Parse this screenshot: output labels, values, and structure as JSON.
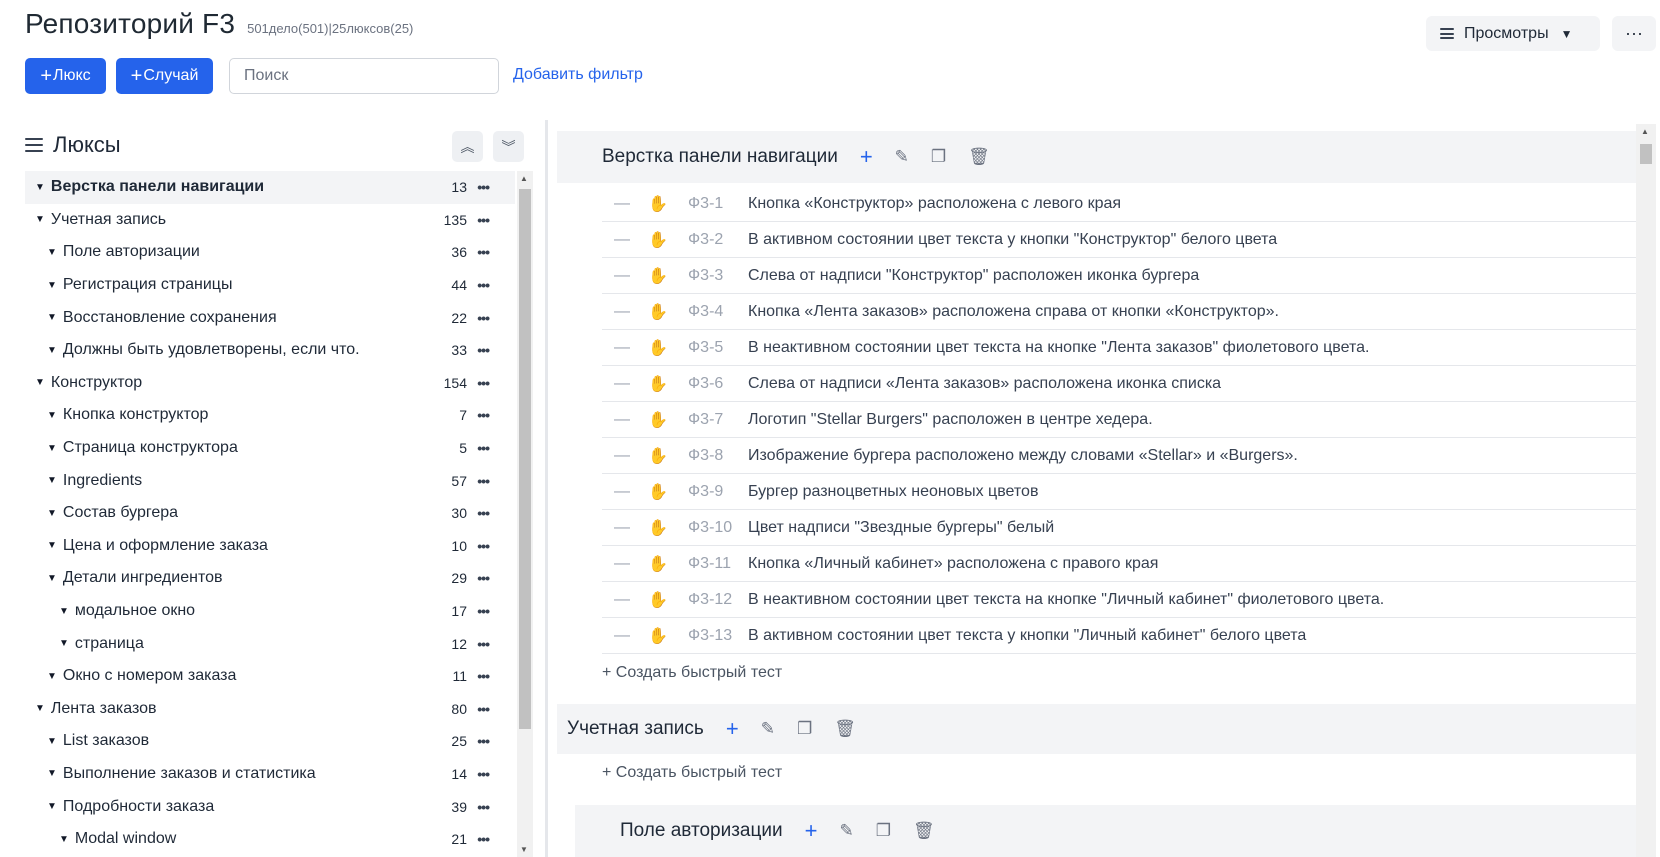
{
  "header": {
    "title": "Репозиторий F3",
    "meta": "501дело(501)|25люксов(25)",
    "suite_button": "Люкс",
    "case_button": "Случай",
    "search_placeholder": "Поиск",
    "add_filter": "Добавить фильтр",
    "views": "Просмотры",
    "more": "···"
  },
  "sidebar": {
    "title": "Люксы",
    "items": [
      {
        "label": "Верстка панели навигации",
        "count": "13",
        "level": 0
      },
      {
        "label": "Учетная запись",
        "count": "135",
        "level": 0
      },
      {
        "label": "Поле авторизации",
        "count": "36",
        "level": 1
      },
      {
        "label": "Регистрация страницы",
        "count": "44",
        "level": 1
      },
      {
        "label": "Восстановление сохранения",
        "count": "22",
        "level": 1
      },
      {
        "label": "Должны быть удовлетворены, если что.",
        "count": "33",
        "level": 1
      },
      {
        "label": "Конструктор",
        "count": "154",
        "level": 0
      },
      {
        "label": "Кнопка конструктор",
        "count": "7",
        "level": 1
      },
      {
        "label": "Страница конструктора",
        "count": "5",
        "level": 1
      },
      {
        "label": "Ingredients",
        "count": "57",
        "level": 1
      },
      {
        "label": "Состав бургера",
        "count": "30",
        "level": 1
      },
      {
        "label": "Цена и оформление заказа",
        "count": "10",
        "level": 1
      },
      {
        "label": "Детали ингредиентов",
        "count": "29",
        "level": 1
      },
      {
        "label": "модальное окно",
        "count": "17",
        "level": 2
      },
      {
        "label": "страница",
        "count": "12",
        "level": 2
      },
      {
        "label": "Окно с номером заказа",
        "count": "11",
        "level": 1
      },
      {
        "label": "Лента заказов",
        "count": "80",
        "level": 0
      },
      {
        "label": "List заказов",
        "count": "25",
        "level": 1
      },
      {
        "label": "Выполнение заказов и статистика",
        "count": "14",
        "level": 1
      },
      {
        "label": "Подробности заказа",
        "count": "39",
        "level": 1
      },
      {
        "label": "Modal window",
        "count": "21",
        "level": 2
      }
    ]
  },
  "main": {
    "section1": {
      "title": "Верстка панели навигации",
      "cases": [
        {
          "id": "Ф3-1",
          "title": "Кнопка «Конструктор» расположена с левого края"
        },
        {
          "id": "Ф3-2",
          "title": "В активном состоянии цвет текста у кнопки \"Конструктор\" белого цвета"
        },
        {
          "id": "Ф3-3",
          "title": "Слева от надписи \"Конструктор\" расположен иконка бургера"
        },
        {
          "id": "Ф3-4",
          "title": "Кнопка «Лента заказов» расположена справа от кнопки «Конструктор»."
        },
        {
          "id": "Ф3-5",
          "title": "В неактивном состоянии цвет текста на кнопке \"Лента заказов\" фиолетового цвета."
        },
        {
          "id": "Ф3-6",
          "title": "Слева от надписи «Лента заказов» расположена иконка списка"
        },
        {
          "id": "Ф3-7",
          "title": "Логотип \"Stellar Burgers\" расположен в центре хедера."
        },
        {
          "id": "Ф3-8",
          "title": "Изображение бургера расположено между словами «Stellar» и «Burgers»."
        },
        {
          "id": "Ф3-9",
          "title": "Бургер разноцветных неоновых цветов"
        },
        {
          "id": "Ф3-10",
          "title": "Цвет надписи \"Звездные бургеры\" белый"
        },
        {
          "id": "Ф3-11",
          "title": "Кнопка «Личный кабинет» расположена с правого края"
        },
        {
          "id": "Ф3-12",
          "title": "В неактивном состоянии цвет текста на кнопке \"Личный кабинет\" фиолетового цвета."
        },
        {
          "id": "Ф3-13",
          "title": "В активном состоянии цвет текста у кнопки \"Личный кабинет\" белого цвета"
        }
      ],
      "quick_test": "+ Создать быстрый тест"
    },
    "section2": {
      "title": "Учетная запись",
      "quick_test": "+ Создать быстрый тест"
    },
    "section3": {
      "title": "Поле авторизации"
    }
  },
  "colors": {
    "accent": "#2563eb",
    "section_bg": "#f3f4f6"
  }
}
